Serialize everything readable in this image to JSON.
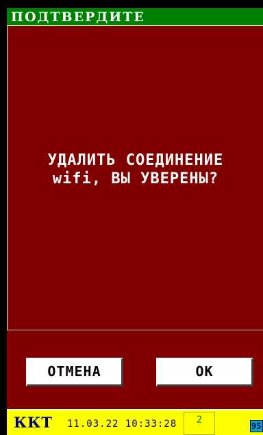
{
  "dialog": {
    "title": "ПОДТВЕРДИТЕ",
    "message_line1": "УДАЛИТЬ СОЕДИНЕНИЕ",
    "message_line2": "wifi, ВЫ УВЕРЕНЫ?"
  },
  "buttons": {
    "cancel_label": "ОТМЕНА",
    "ok_label": "ОК"
  },
  "status_bar": {
    "device_label": "ККТ",
    "datetime": "11.03.22 10:33:28",
    "counter": "2",
    "battery": "95"
  },
  "colors": {
    "header_bg": "#008000",
    "dialog_bg": "#800000",
    "status_bg": "#ffff00",
    "status_text": "#000080",
    "battery_bg": "#00aaaa"
  }
}
